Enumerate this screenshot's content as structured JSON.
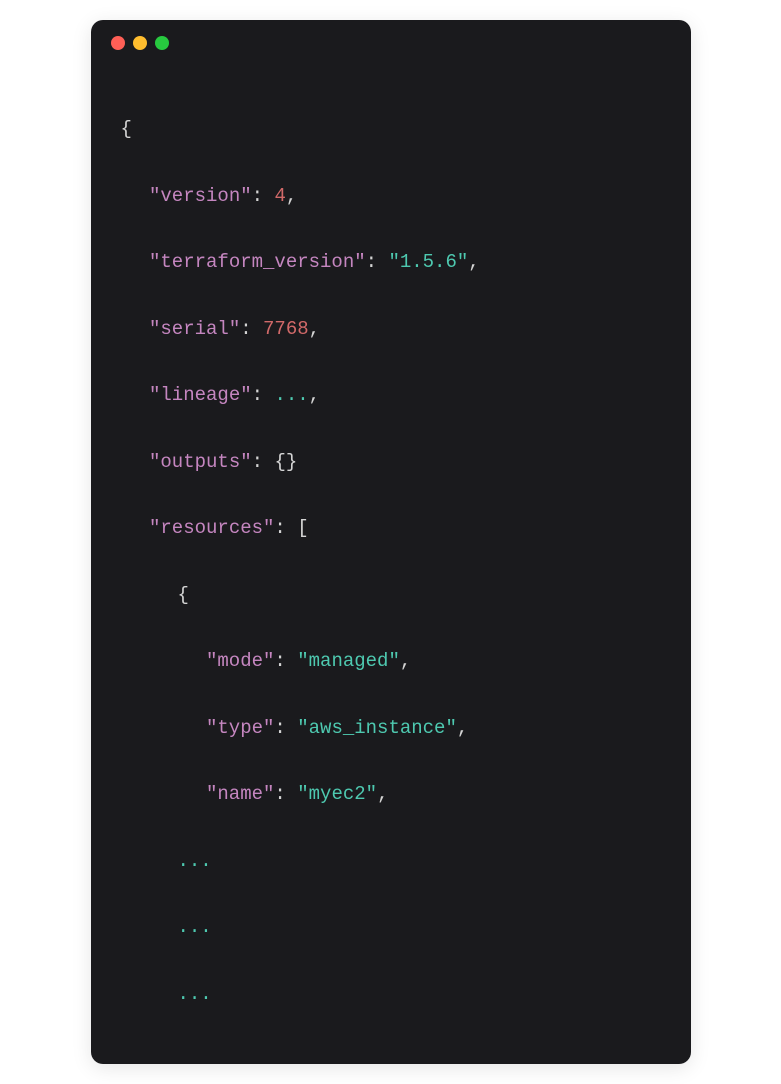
{
  "code": {
    "open_brace": "{",
    "k_version": "\"version\"",
    "v_version": "4",
    "k_terraform_version": "\"terraform_version\"",
    "v_terraform_version": "\"1.5.6\"",
    "k_serial": "\"serial\"",
    "v_serial": "7768",
    "k_lineage": "\"lineage\"",
    "v_lineage": "...",
    "k_outputs": "\"outputs\"",
    "v_outputs": "{}",
    "k_resources": "\"resources\"",
    "v_resources_open": "[",
    "resource_open": "{",
    "k_mode": "\"mode\"",
    "v_mode": "\"managed\"",
    "k_type": "\"type\"",
    "v_type": "\"aws_instance\"",
    "k_name": "\"name\"",
    "v_name": "\"myec2\"",
    "ellipsis1": "...",
    "ellipsis2": "...",
    "ellipsis3": "...",
    "colon": ": ",
    "comma": ","
  }
}
